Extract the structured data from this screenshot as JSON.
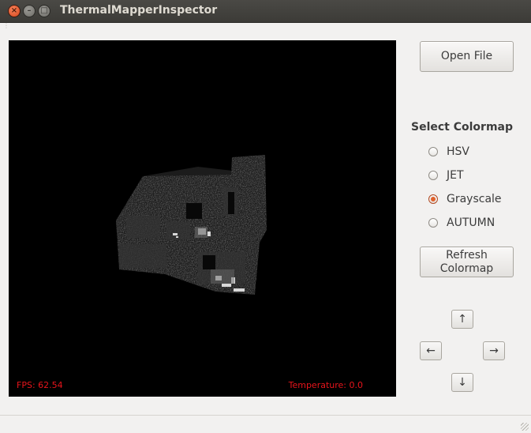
{
  "window": {
    "title": "ThermalMapperInspector",
    "close_glyph": "×",
    "min_glyph": "–",
    "max_glyph": "□"
  },
  "viewport": {
    "fps_text": "FPS: 62.54",
    "temperature_text": "Temperature: 0.0",
    "overlay_color": "#e6141b"
  },
  "controls": {
    "open_file_label": "Open File",
    "colormap_heading": "Select Colormap",
    "colormaps": [
      {
        "label": "HSV",
        "checked": false
      },
      {
        "label": "JET",
        "checked": false
      },
      {
        "label": "Grayscale",
        "checked": true
      },
      {
        "label": "AUTUMN",
        "checked": false
      }
    ],
    "refresh_label_line1": "Refresh",
    "refresh_label_line2": "Colormap",
    "arrows": {
      "up": "↑",
      "left": "←",
      "right": "→",
      "down": "↓"
    }
  },
  "colors": {
    "accent": "#e0622d",
    "titlebar": "#3c3b37",
    "window_bg": "#f2f1f0"
  }
}
